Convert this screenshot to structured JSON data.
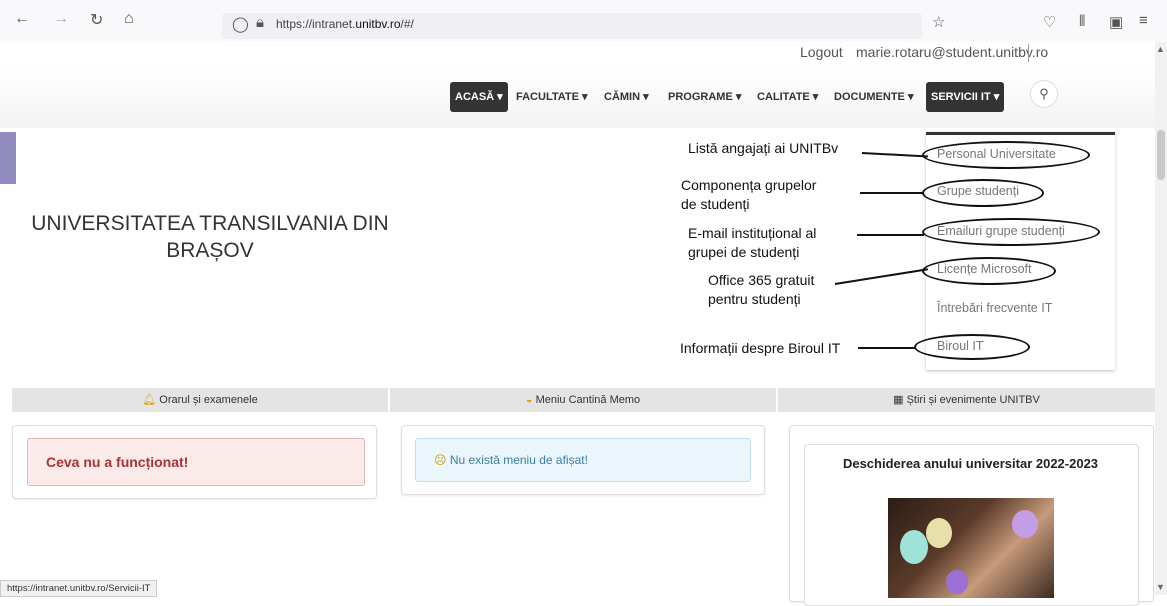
{
  "browser": {
    "url_prefix": "https://intranet.",
    "url_domain": "unitbv.ro",
    "url_suffix": "/#/",
    "status_url": "https://intranet.unitbv.ro/Servicii-IT"
  },
  "header": {
    "logout": "Logout",
    "email": "marie.rotaru@student.unitbv.ro"
  },
  "nav": [
    {
      "label": "ACASĂ ▾"
    },
    {
      "label": "FACULTATE ▾"
    },
    {
      "label": "CĂMIN ▾"
    },
    {
      "label": "PROGRAME ▾"
    },
    {
      "label": "CALITATE ▾"
    },
    {
      "label": "DOCUMENTE ▾"
    },
    {
      "label": "SERVICII IT ▾"
    }
  ],
  "university": {
    "line1": "UNIVERSITATEA TRANSILVANIA DIN",
    "line2": "BRAȘOV"
  },
  "dropdown": [
    "Personal Universitate",
    "Grupe studenți",
    "Emailuri grupe studenți",
    "Licențe Microsoft",
    "Întrebări frecvente IT",
    "Biroul IT"
  ],
  "annotations": {
    "a1": "Listă angajați ai UNITBv",
    "a2_l1": "Componența grupelor",
    "a2_l2": "de studenți",
    "a3_l1": "E-mail instituțional al",
    "a3_l2": "grupei de studenți",
    "a4_l1": "Office 365 gratuit",
    "a4_l2": "pentru studenți",
    "a5": "Informații despre Biroul IT"
  },
  "sections": {
    "schedule": "Orarul și examenele",
    "menu": "Meniu Cantină Memo",
    "news": "Știri și evenimente UNITBV"
  },
  "alerts": {
    "error": "Ceva nu a funcționat!",
    "info": "Nu există meniu de afișat!"
  },
  "news": {
    "title": "Deschiderea anului universitar 2022-2023"
  },
  "colors": {
    "accent_dark": "#333333",
    "error": "#aa3333",
    "info": "#3a7fa0"
  }
}
